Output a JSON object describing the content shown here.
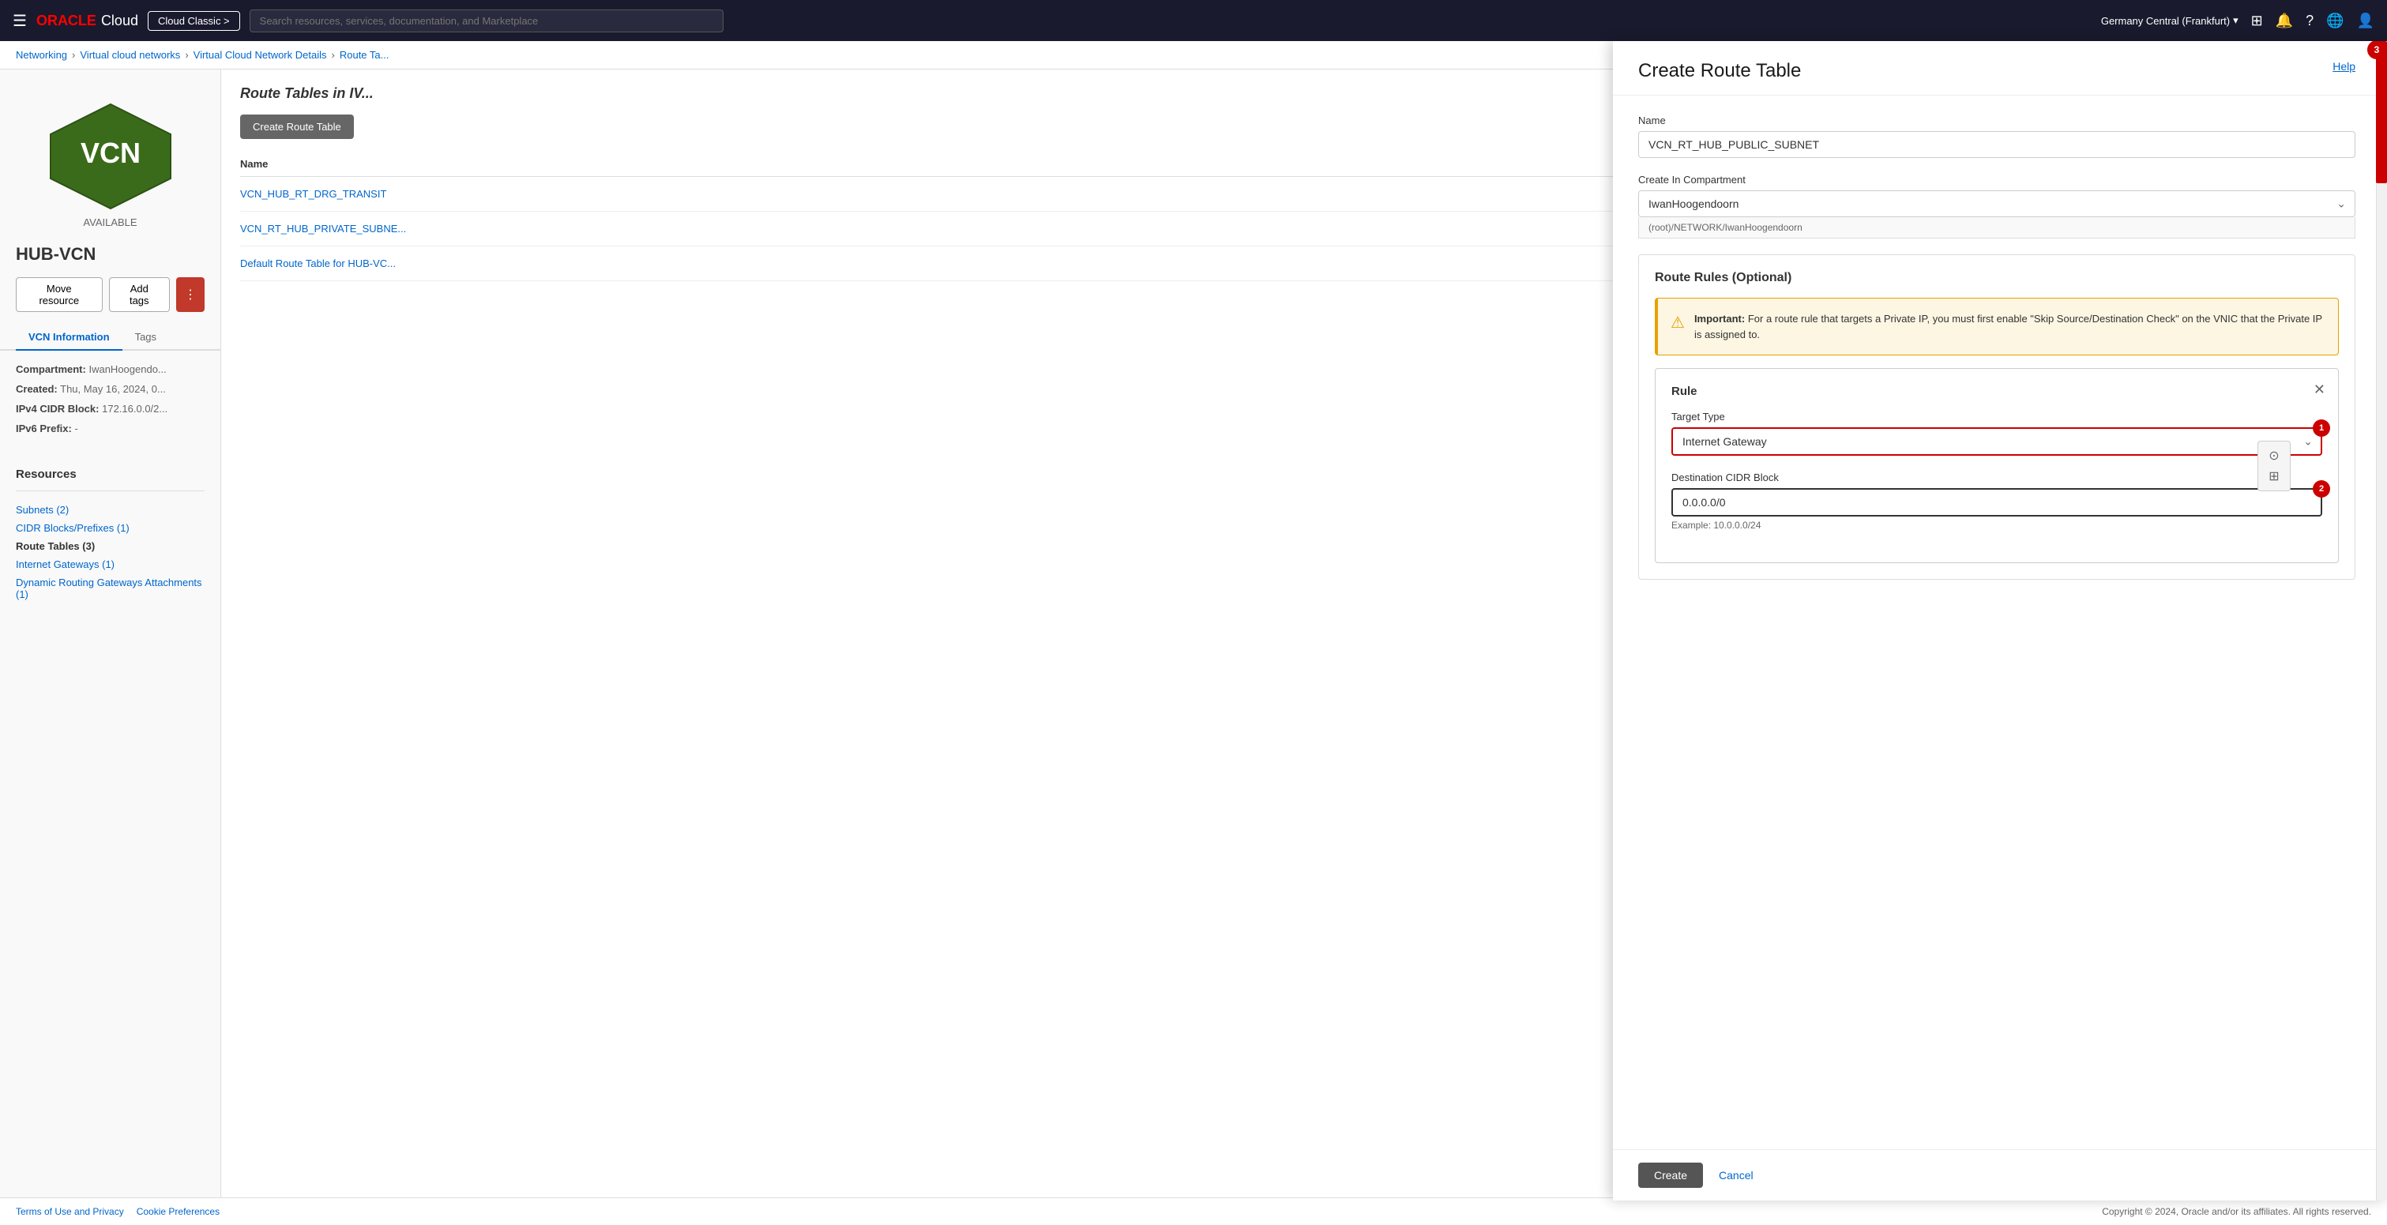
{
  "topnav": {
    "hamburger": "☰",
    "logo": "ORACLE Cloud",
    "cloud_classic_label": "Cloud Classic >",
    "search_placeholder": "Search resources, services, documentation, and Marketplace",
    "region": "Germany Central (Frankfurt)",
    "icons": {
      "console": "⊞",
      "bell": "🔔",
      "help": "?",
      "globe": "🌐",
      "user": "👤"
    }
  },
  "breadcrumb": {
    "items": [
      "Networking",
      "Virtual cloud networks",
      "Virtual Cloud Network Details",
      "Route Ta..."
    ]
  },
  "sidebar": {
    "vcn_name": "HUB-VCN",
    "vcn_status": "AVAILABLE",
    "action_buttons": [
      "Move resource",
      "Add tags"
    ],
    "tabs": [
      "VCN Information",
      "Tags"
    ],
    "info": {
      "compartment_label": "Compartment:",
      "compartment_value": "IwanHoogendo...",
      "created_label": "Created:",
      "created_value": "Thu, May 16, 2024, 0...",
      "ipv4_label": "IPv4 CIDR Block:",
      "ipv4_value": "172.16.0.0/2...",
      "ipv6_label": "IPv6 Prefix:",
      "ipv6_value": "-"
    },
    "resources": {
      "title": "Resources",
      "items": [
        {
          "label": "Subnets (2)",
          "active": false
        },
        {
          "label": "CIDR Blocks/Prefixes (1)",
          "active": false
        },
        {
          "label": "Route Tables (3)",
          "active": true
        },
        {
          "label": "Internet Gateways (1)",
          "active": false
        },
        {
          "label": "Dynamic Routing Gateways Attachments (1)",
          "active": false
        }
      ]
    }
  },
  "main": {
    "title": "Route Tables in IV...",
    "create_btn": "Create Route Table",
    "table": {
      "column": "Name",
      "rows": [
        "VCN_HUB_RT_DRG_TRANSIT",
        "VCN_RT_HUB_PRIVATE_SUBNE...",
        "Default Route Table for HUB-VC..."
      ]
    }
  },
  "modal": {
    "title": "Create Route Table",
    "help_link": "Help",
    "form": {
      "name_label": "Name",
      "name_value": "VCN_RT_HUB_PUBLIC_SUBNET",
      "compartment_label": "Create In Compartment",
      "compartment_value": "IwanHoogendoorn",
      "compartment_hint": "(root)/NETWORK/IwanHoogendoorn"
    },
    "route_rules": {
      "section_title": "Route Rules (Optional)",
      "warning": {
        "icon": "⚠",
        "title": "Important:",
        "text": "For a route rule that targets a Private IP, you must first enable \"Skip Source/Destination Check\" on the VNIC that the Private IP is assigned to."
      },
      "rule": {
        "title": "Rule",
        "target_type_label": "Target Type",
        "target_type_value": "Internet Gateway",
        "dest_cidr_label": "Destination CIDR Block",
        "dest_cidr_value": "0.0.0.0/0",
        "dest_example": "Example: 10.0.0.0/24"
      }
    },
    "footer": {
      "create_btn": "Create",
      "cancel_btn": "Cancel"
    },
    "scroll_badge": "3"
  }
}
